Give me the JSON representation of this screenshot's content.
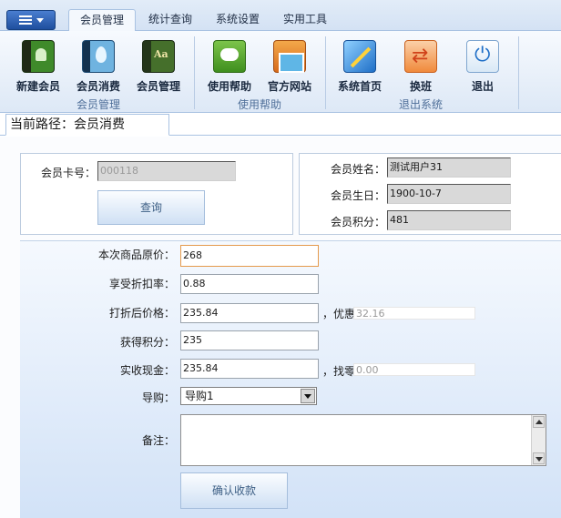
{
  "ribbon": {
    "tabs": [
      "会员管理",
      "统计查询",
      "系统设置",
      "实用工具"
    ],
    "buttons": {
      "new_member": "新建会员",
      "member_consume": "会员消费",
      "member_manage": "会员管理",
      "help": "使用帮助",
      "official_site": "官方网站",
      "home": "系统首页",
      "shift": "换班",
      "exit": "退出"
    },
    "groups": {
      "member": "会员管理",
      "help": "使用帮助",
      "exit": "退出系统"
    }
  },
  "breadcrumb": {
    "text": "当前路径：会员消费"
  },
  "lookup": {
    "card_label": "会员卡号：",
    "card_value": "000118",
    "query_button": "查询"
  },
  "member": {
    "name_label": "会员姓名：",
    "name_value": "测试用户31",
    "birthday_label": "会员生日：",
    "birthday_value": "1900-10-7",
    "points_label": "会员积分：",
    "points_value": "481"
  },
  "purchase": {
    "original_price_label": "本次商品原价：",
    "original_price_value": "268",
    "discount_label": "享受折扣率：",
    "discount_value": "0.88",
    "discounted_label": "打折后价格：",
    "discounted_value": "235.84",
    "saving_label": "，优惠",
    "saving_value": "32.16",
    "earned_points_label": "获得积分：",
    "earned_points_value": "235",
    "cash_label": "实收现金：",
    "cash_value": "235.84",
    "change_label": "，找零",
    "change_value": "0.00",
    "guide_label": "导购：",
    "guide_value": "导购1",
    "note_label": "备注：",
    "note_value": "",
    "confirm_button": "确认收款"
  }
}
